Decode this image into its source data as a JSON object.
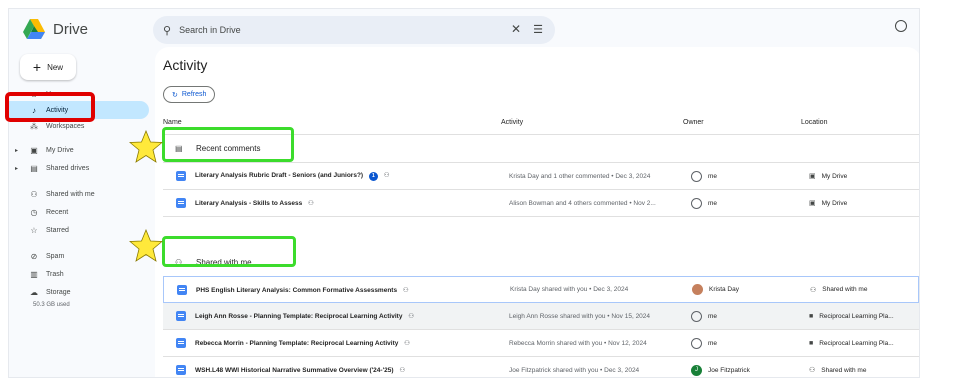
{
  "app": {
    "name": "Drive"
  },
  "search": {
    "placeholder": "Search in Drive"
  },
  "sidebar": {
    "new_label": "New",
    "items": [
      {
        "label": "Home",
        "icon": "home-icon"
      },
      {
        "label": "Activity",
        "icon": "bell-icon"
      },
      {
        "label": "Workspaces",
        "icon": "workspaces-icon"
      },
      {
        "label": "My Drive",
        "icon": "my-drive-icon"
      },
      {
        "label": "Shared drives",
        "icon": "shared-drives-icon"
      },
      {
        "label": "Shared with me",
        "icon": "people-icon"
      },
      {
        "label": "Recent",
        "icon": "clock-icon"
      },
      {
        "label": "Starred",
        "icon": "star-icon"
      },
      {
        "label": "Spam",
        "icon": "spam-icon"
      },
      {
        "label": "Trash",
        "icon": "trash-icon"
      },
      {
        "label": "Storage",
        "icon": "cloud-icon"
      }
    ],
    "storage_used": "50.3 GB used"
  },
  "main": {
    "title": "Activity",
    "refresh_label": "Refresh",
    "columns": {
      "name": "Name",
      "activity": "Activity",
      "owner": "Owner",
      "location": "Location"
    },
    "sections": {
      "recent_comments": "Recent comments",
      "shared_with_me": "Shared with me"
    },
    "recent_rows": [
      {
        "name": "Literary Analysis Rubric Draft - Seniors (and Juniors?)",
        "badge": "1",
        "activity": "Krista Day and 1 other commented • Dec 3, 2024",
        "owner": "me",
        "location": "My Drive"
      },
      {
        "name": "Literary Analysis - Skills to Assess",
        "activity": "Alison Bowman and 4 others commented • Nov 2...",
        "owner": "me",
        "location": "My Drive"
      }
    ],
    "shared_rows": [
      {
        "name": "PHS English Literary Analysis: Common Formative Assessments",
        "activity": "Krista Day shared with you • Dec 3, 2024",
        "owner": "Krista Day",
        "location": "Shared with me"
      },
      {
        "name": "Leigh Ann Rosse - Planning Template: Reciprocal Learning Activity",
        "activity": "Leigh Ann Rosse shared with you • Nov 15, 2024",
        "owner": "me",
        "location": "Reciprocal Learning Pla..."
      },
      {
        "name": "Rebecca Morrin - Planning Template: Reciprocal Learning Activity",
        "activity": "Rebecca Morrin shared with you • Nov 12, 2024",
        "owner": "me",
        "location": "Reciprocal Learning Pla..."
      },
      {
        "name": "WSH.L48 WWI Historical Narrative Summative Overview ('24-'25)",
        "activity": "Joe Fitzpatrick shared with you • Dec 3, 2024",
        "owner": "Joe Fitzpatrick",
        "owner_initial": "J",
        "location": "Shared with me"
      }
    ]
  },
  "colors": {
    "accent": "#0b57d0",
    "active_nav": "#c2e7ff",
    "annotation_red": "#e00000",
    "annotation_green": "#3cdc2c",
    "annotation_star": "#ffe93b"
  }
}
